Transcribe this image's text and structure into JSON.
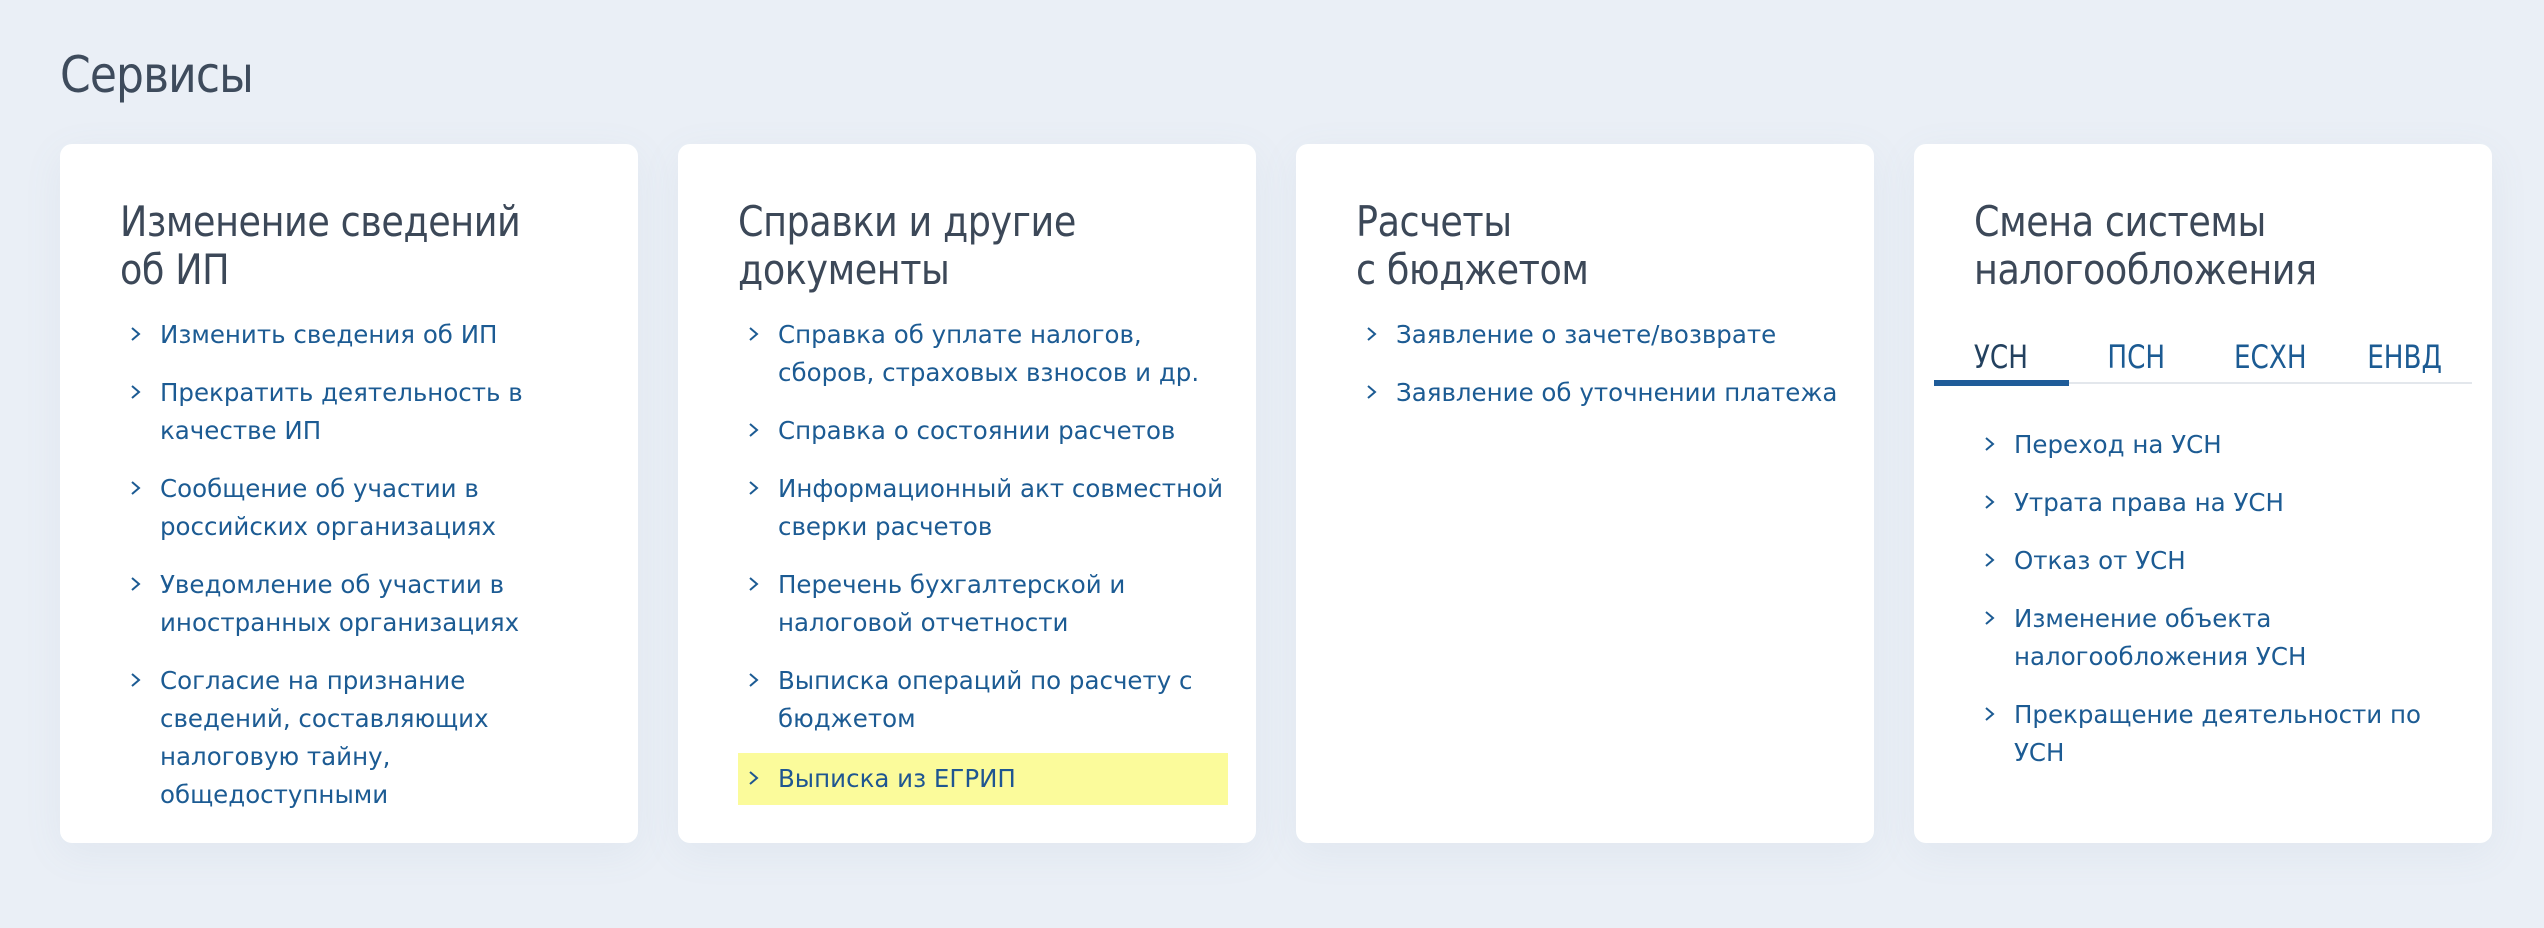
{
  "page": {
    "title": "Сервисы"
  },
  "cards": [
    {
      "title": [
        "Изменение сведений",
        "об ИП"
      ],
      "links": [
        "Изменить сведения об ИП",
        "Прекратить деятельность в качестве ИП",
        "Сообщение об участии в российских организациях",
        "Уведомление об участии в иностранных организациях",
        "Согласие на признание сведений, составляющих налоговую тайну, общедоступными"
      ]
    },
    {
      "title": [
        "Справки и другие",
        "документы"
      ],
      "links": [
        "Справка об уплате налогов, сборов, страховых взносов и др.",
        "Справка о состоянии расчетов",
        "Информационный акт совместной сверки расчетов",
        "Перечень бухгалтерской и налоговой отчетности",
        "Выписка операций по расчету с бюджетом",
        "Выписка из ЕГРИП"
      ]
    },
    {
      "title": [
        "Расчеты",
        "с бюджетом"
      ],
      "links": [
        "Заявление о зачете/возврате",
        "Заявление об уточнении платежа"
      ]
    },
    {
      "title": [
        "Смена системы",
        "налогообложения"
      ],
      "tabs": [
        "УСН",
        "ПСН",
        "ЕСХН",
        "ЕНВД"
      ],
      "active_tab": "УСН",
      "links": [
        "Переход на УСН",
        "Утрата права на УСН",
        "Отказ от УСН",
        "Изменение объекта налогообложения УСН",
        "Прекращение деятельности по УСН"
      ]
    }
  ],
  "colors": {
    "background": "#eaeff6",
    "card": "#ffffff",
    "link": "#1c5b93",
    "heading": "#3c4858",
    "highlight": "#fbfb9b",
    "tab_underline": "#1f5c99"
  },
  "icons": {
    "link_bullet": "chevron-right-icon"
  }
}
